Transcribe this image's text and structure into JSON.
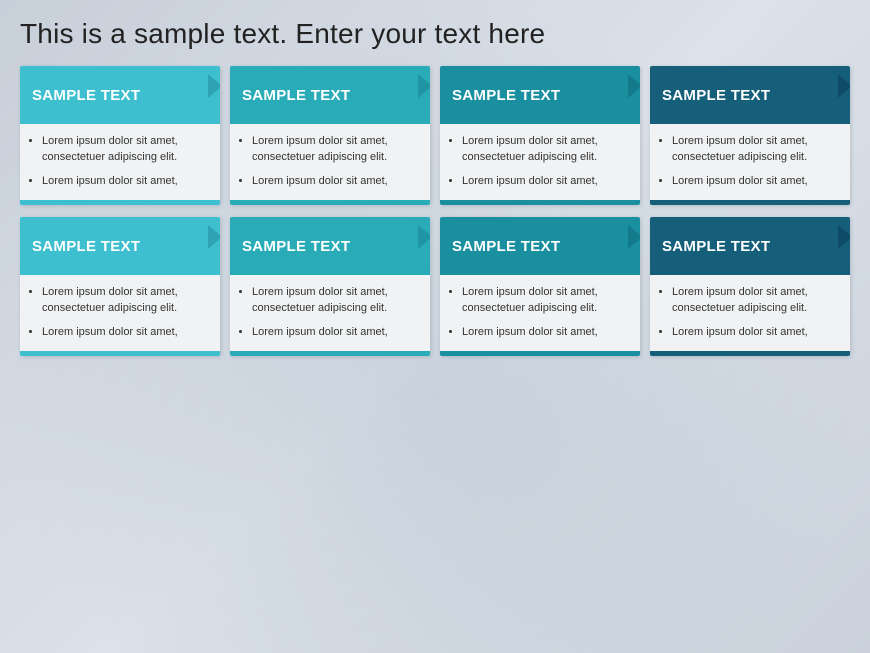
{
  "page": {
    "title": "This is a sample text.  Enter your text here"
  },
  "rows": [
    {
      "cards": [
        {
          "id": "r1c1",
          "header": "SAMPLE TEXT",
          "color_class": "color-1",
          "bar_class": "bottom-bar-1",
          "bullets": [
            "Lorem ipsum dolor sit amet, consectetuer adipiscing elit.",
            "Lorem ipsum dolor sit amet,"
          ]
        },
        {
          "id": "r1c2",
          "header": "SAMPLE TEXT",
          "color_class": "color-2",
          "bar_class": "bottom-bar-2",
          "bullets": [
            "Lorem ipsum dolor sit amet, consectetuer adipiscing elit.",
            "Lorem ipsum dolor sit amet,"
          ]
        },
        {
          "id": "r1c3",
          "header": "SAMPLE TEXT",
          "color_class": "color-3",
          "bar_class": "bottom-bar-3",
          "bullets": [
            "Lorem ipsum dolor sit amet, consectetuer adipiscing elit.",
            "Lorem ipsum dolor sit amet,"
          ]
        },
        {
          "id": "r1c4",
          "header": "SAMPLE TEXT",
          "color_class": "color-4",
          "bar_class": "bottom-bar-4",
          "bullets": [
            "Lorem ipsum dolor sit amet, consectetuer adipiscing elit.",
            "Lorem ipsum dolor sit amet,"
          ]
        }
      ]
    },
    {
      "cards": [
        {
          "id": "r2c1",
          "header": "SAMPLE TEXT",
          "color_class": "color-1",
          "bar_class": "bottom-bar-1",
          "bullets": [
            "Lorem ipsum dolor sit amet, consectetuer adipiscing elit.",
            "Lorem ipsum dolor sit amet,"
          ]
        },
        {
          "id": "r2c2",
          "header": "SAMPLE TEXT",
          "color_class": "color-2",
          "bar_class": "bottom-bar-2",
          "bullets": [
            "Lorem ipsum dolor sit amet, consectetuer adipiscing elit.",
            "Lorem ipsum dolor sit amet,"
          ]
        },
        {
          "id": "r2c3",
          "header": "SAMPLE TEXT",
          "color_class": "color-3",
          "bar_class": "bottom-bar-3",
          "bullets": [
            "Lorem ipsum dolor sit amet, consectetuer adipiscing elit.",
            "Lorem ipsum dolor sit amet,"
          ]
        },
        {
          "id": "r2c4",
          "header": "SAMPLE TEXT",
          "color_class": "color-4",
          "bar_class": "bottom-bar-4",
          "bullets": [
            "Lorem ipsum dolor sit amet, consectetuer adipiscing elit.",
            "Lorem ipsum dolor sit amet,"
          ]
        }
      ]
    }
  ]
}
